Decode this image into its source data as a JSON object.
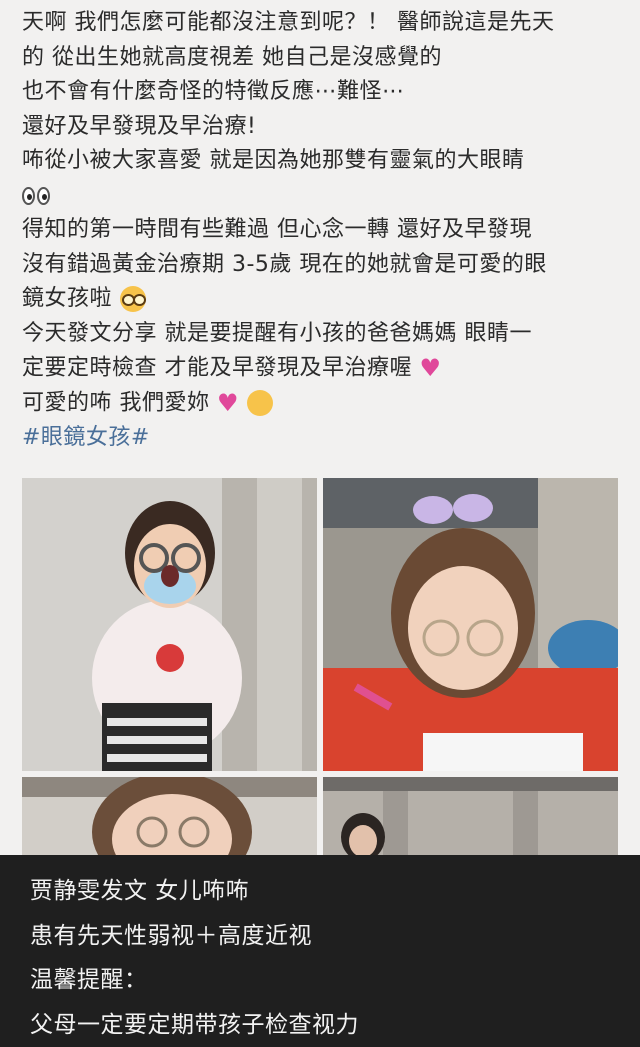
{
  "post": {
    "lines": [
      "天啊 我們怎麼可能都沒注意到呢？！ 醫師說這是先天",
      "的 從出生她就高度視差 她自己是沒感覺的",
      "也不會有什麼奇怪的特徵反應⋯難怪⋯",
      " 還好及早發現及早治療!",
      "咘從小被大家喜愛 就是因為她那雙有靈氣的大眼睛",
      "得知的第一時間有些難過 但心念一轉 還好及早發現",
      "沒有錯過黃金治療期 3-5歲 現在的她就會是可愛的眼",
      "鏡女孩啦",
      " 今天發文分享 就是要提醒有小孩的爸爸媽媽 眼睛一",
      "定要定時檢查 才能及早發現及早治療喔",
      "可愛的咘 我們愛妳"
    ],
    "hashtag": "#眼鏡女孩#",
    "emoji": {
      "eyes": "eyes-emoji",
      "nerd": "nerd-face-emoji",
      "hearts": "two-hearts-emoji",
      "sparkle_heart": "sparkling-heart-emoji",
      "kiss": "face-blowing-kiss-emoji"
    }
  },
  "photos": [
    {
      "name": "girl-eye-test-photo"
    },
    {
      "name": "girl-drawing-glasses-photo"
    },
    {
      "name": "girl-glasses-closeup-photo"
    },
    {
      "name": "woman-indoor-photo"
    }
  ],
  "caption": {
    "lines": [
      "贾静雯发文 女儿咘咘",
      "患有先天性弱视＋高度近视",
      "温馨提醒：",
      "父母一定要定期带孩子检查视力"
    ]
  },
  "colors": {
    "background": "#f2f1f0",
    "hashtag": "#4a6f99",
    "caption_bg": "#1f1f1f",
    "heart": "#e0489a"
  }
}
